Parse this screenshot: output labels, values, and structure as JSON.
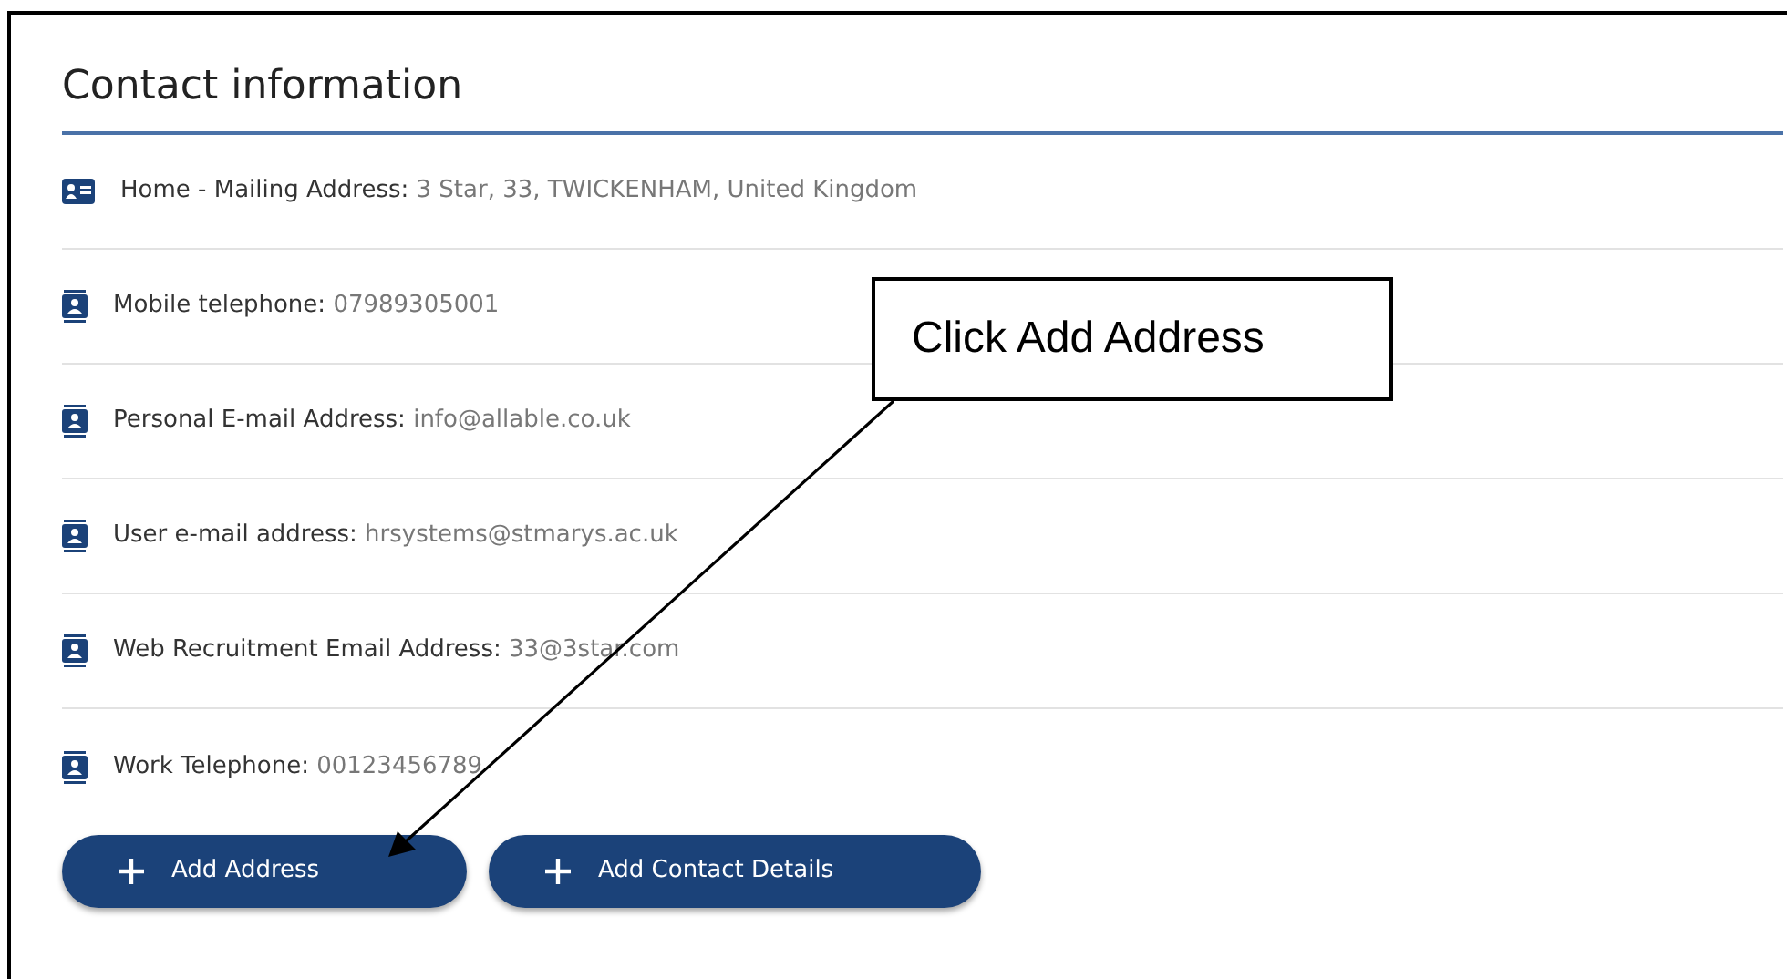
{
  "section": {
    "title": "Contact information"
  },
  "items": [
    {
      "kind": "address",
      "label": "Home - Mailing Address:",
      "value": "3 Star, 33, TWICKENHAM, United Kingdom"
    },
    {
      "kind": "contact",
      "label": "Mobile telephone:",
      "value": "07989305001"
    },
    {
      "kind": "contact",
      "label": "Personal E-mail Address:",
      "value": "info@allable.co.uk"
    },
    {
      "kind": "contact",
      "label": "User e-mail address:",
      "value": "hrsystems@stmarys.ac.uk"
    },
    {
      "kind": "contact",
      "label": "Web Recruitment Email Address:",
      "value": "33@3star.com"
    },
    {
      "kind": "contact",
      "label": "Work Telephone:",
      "value": "00123456789"
    }
  ],
  "buttons": [
    {
      "label": "Add Address"
    },
    {
      "label": "Add Contact Details"
    }
  ],
  "callout": {
    "text": "Click Add Address"
  }
}
